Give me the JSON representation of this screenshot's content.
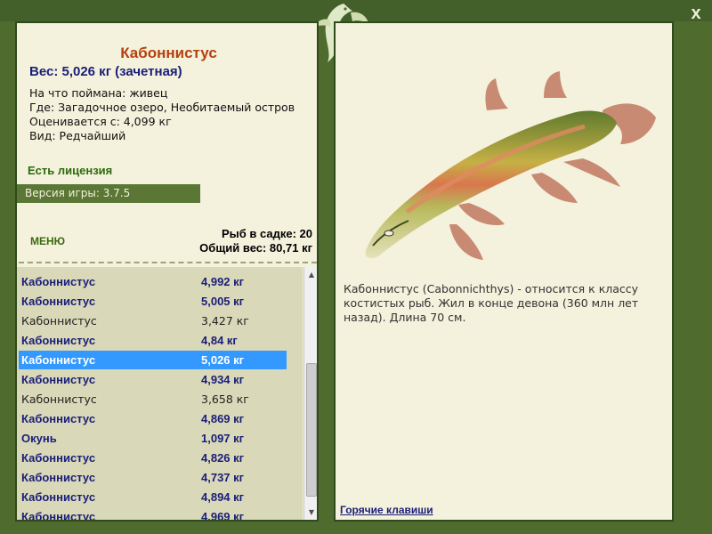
{
  "window": {
    "close_label": "x"
  },
  "fish": {
    "name": "Кабоннистус",
    "weight_text": "Вес: 5,026 кг (зачетная)",
    "caught_on": "На что поймана: живец",
    "location": "Где: Загадочное озеро, Необитаемый остров",
    "rated_from": "Оценивается с: 4,099 кг",
    "rarity": "Вид: Редчайший",
    "description": "Кабоннистус (Cabonnichthys) - относится к классу костистых рыб. Жил в конце девона (360 млн лет назад). Длина 70 см."
  },
  "license": "Есть лицензия",
  "version": "Версия игры: 3.7.5",
  "menu_label": "МЕНЮ",
  "cage": {
    "count_text": "Рыб в садке: 20",
    "total_weight_text": "Общий вес: 80,71 кг"
  },
  "catch_list": [
    {
      "name": "Кабоннистус",
      "weight": "4,992 кг",
      "style": "bold"
    },
    {
      "name": "Кабоннистус",
      "weight": "5,005 кг",
      "style": "bold"
    },
    {
      "name": "Кабоннистус",
      "weight": "3,427 кг",
      "style": "normal"
    },
    {
      "name": "Кабоннистус",
      "weight": "4,84 кг",
      "style": "bold"
    },
    {
      "name": "Кабоннистус",
      "weight": "5,026 кг",
      "style": "selected"
    },
    {
      "name": "Кабоннистус",
      "weight": "4,934 кг",
      "style": "bold"
    },
    {
      "name": "Кабоннистус",
      "weight": "3,658 кг",
      "style": "normal"
    },
    {
      "name": "Кабоннистус",
      "weight": "4,869 кг",
      "style": "bold"
    },
    {
      "name": "Окунь",
      "weight": "1,097 кг",
      "style": "bold"
    },
    {
      "name": "Кабоннистус",
      "weight": "4,826 кг",
      "style": "bold"
    },
    {
      "name": "Кабоннистус",
      "weight": "4,737 кг",
      "style": "bold"
    },
    {
      "name": "Кабоннистус",
      "weight": "4,894 кг",
      "style": "bold"
    },
    {
      "name": "Кабоннистус",
      "weight": "4.969 кг",
      "style": "bold"
    }
  ],
  "hotkeys_label": "Горячие клавиши",
  "colors": {
    "frame": "#4f6b2d",
    "panel": "#f4f1dc",
    "title": "#b5410e",
    "link": "#1a1e78",
    "selection": "#3399ff"
  },
  "icons": {
    "close": "close-icon",
    "ornament": "fish-ornament-icon",
    "scroll_up": "scroll-up-icon",
    "scroll_down": "scroll-down-icon"
  }
}
